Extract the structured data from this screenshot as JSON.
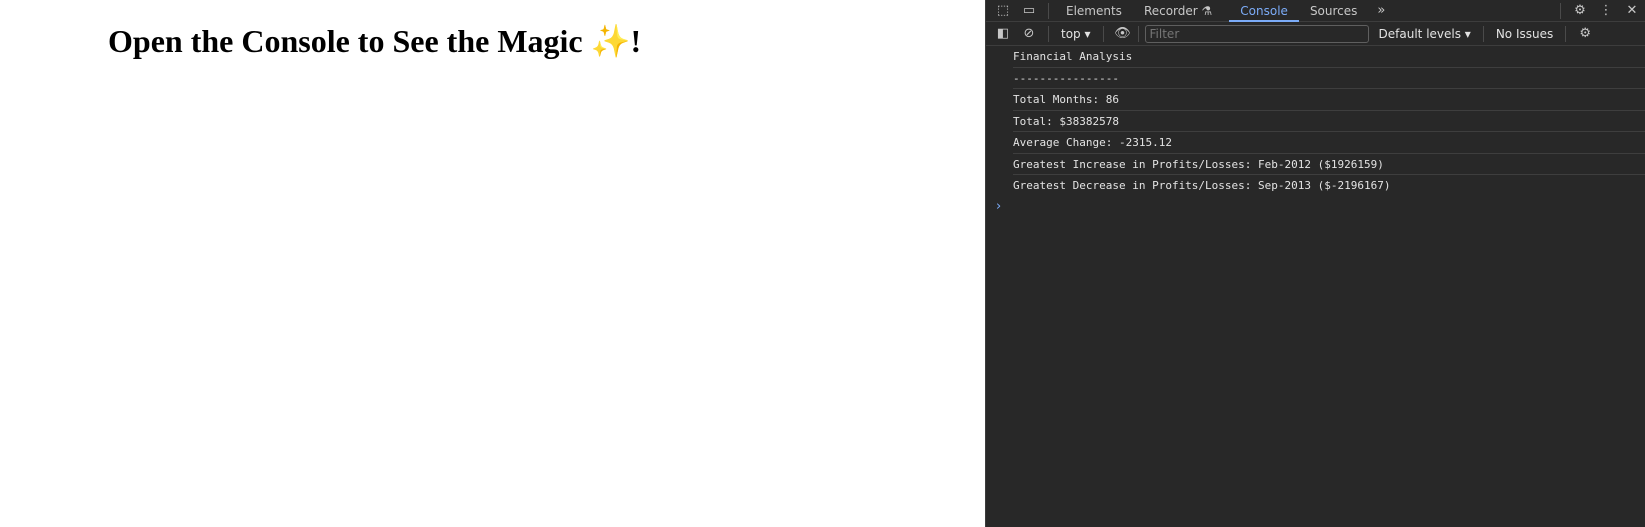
{
  "page": {
    "heading": "Open the Console to See the Magic ",
    "sparkle": "✨",
    "heading_end": "!"
  },
  "devtools": {
    "tabs": [
      "Elements",
      "Recorder ⚗",
      "Console",
      "Sources"
    ],
    "active_tab": "Console",
    "more_tabs": "»",
    "context": "top",
    "filter_placeholder": "Filter",
    "levels": "Default levels ▾",
    "issues": "No Issues",
    "accent": "#7cacf8",
    "console_lines": [
      "Financial Analysis",
      "----------------",
      "Total Months: 86",
      "Total: $38382578",
      "Average Change: -2315.12",
      "Greatest Increase in Profits/Losses: Feb-2012 ($1926159)",
      "Greatest Decrease in Profits/Losses: Sep-2013 ($-2196167)"
    ],
    "prompt": "›"
  }
}
